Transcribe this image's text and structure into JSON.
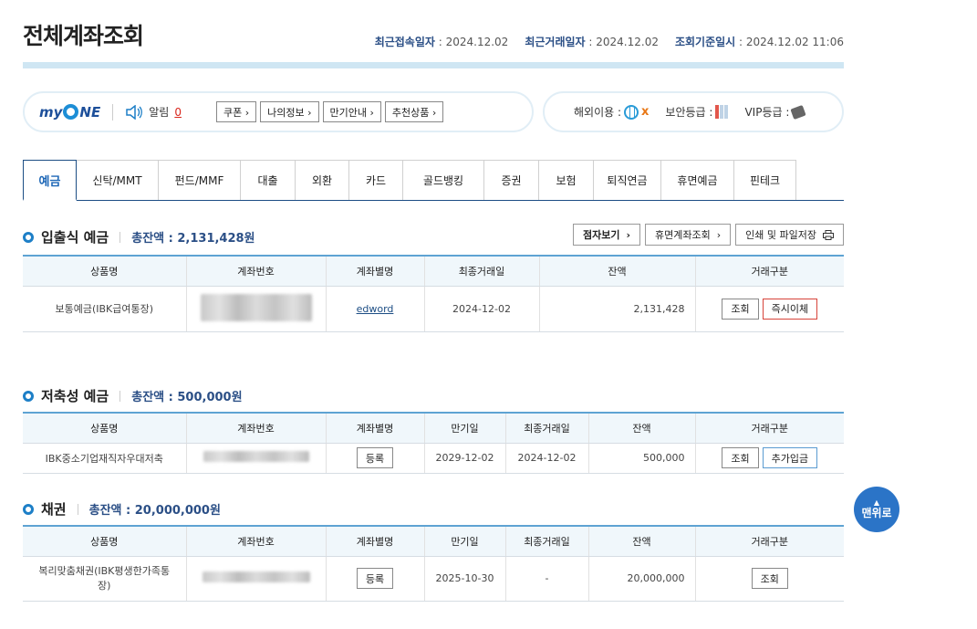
{
  "page": {
    "title": "전체계좌조회",
    "meta": [
      {
        "key": "최근접속일자",
        "value": " : 2024.12.02"
      },
      {
        "key": "최근거래일자",
        "value": " : 2024.12.02"
      },
      {
        "key": "조회기준일시",
        "value": " : 2024.12.02 11:06"
      }
    ]
  },
  "myone": {
    "logo_left": "my",
    "logo_right": "NE",
    "alarm_label": "알림",
    "alarm_count": "0",
    "chips": [
      "쿠폰 ›",
      "나의정보 ›",
      "만기안내 ›",
      "추천상품 ›"
    ]
  },
  "status": {
    "overseas_label": "해외이용 :",
    "security_label": "보안등급 :",
    "vip_label": "VIP등급 :"
  },
  "tabs": [
    {
      "label": "예금",
      "active": true
    },
    {
      "label": "신탁/MMT"
    },
    {
      "label": "펀드/MMF"
    },
    {
      "label": "대출"
    },
    {
      "label": "외환"
    },
    {
      "label": "카드"
    },
    {
      "label": "골드뱅킹"
    },
    {
      "label": "증권"
    },
    {
      "label": "보험"
    },
    {
      "label": "퇴직연금"
    },
    {
      "label": "휴면예금"
    },
    {
      "label": "핀테크"
    }
  ],
  "actions": {
    "braille": "점자보기",
    "dormant": "휴면계좌조회",
    "print": "인쇄 및 파일저장"
  },
  "deposit": {
    "name": "입출식 예금",
    "total": "총잔액 : 2,131,428원",
    "headers": [
      "상품명",
      "계좌번호",
      "계좌별명",
      "최종거래일",
      "잔액",
      "거래구분"
    ],
    "row": {
      "product": "보통예금(IBK급여통장)",
      "alias": "edword",
      "last_date": "2024-12-02",
      "balance": "2,131,428",
      "btn1": "조회",
      "btn2": "즉시이체"
    }
  },
  "savings": {
    "name": "저축성 예금",
    "total": "총잔액 : 500,000원",
    "headers": [
      "상품명",
      "계좌번호",
      "계좌별명",
      "만기일",
      "최종거래일",
      "잔액",
      "거래구분"
    ],
    "row": {
      "product": "IBK중소기업재직자우대저축",
      "alias_btn": "등록",
      "maturity": "2029-12-02",
      "last_date": "2024-12-02",
      "balance": "500,000",
      "btn1": "조회",
      "btn2": "추가입금"
    }
  },
  "bond": {
    "name": "채권",
    "total": "총잔액 : 20,000,000원",
    "headers": [
      "상품명",
      "계좌번호",
      "계좌별명",
      "만기일",
      "최종거래일",
      "잔액",
      "거래구분"
    ],
    "row": {
      "product": "복리맞춤채권(IBK평생한가족통장)",
      "alias_btn": "등록",
      "maturity": "2025-10-30",
      "last_date": "-",
      "balance": "20,000,000",
      "btn1": "조회"
    }
  },
  "top_button": {
    "arrow": "▲",
    "label": "맨위로"
  }
}
